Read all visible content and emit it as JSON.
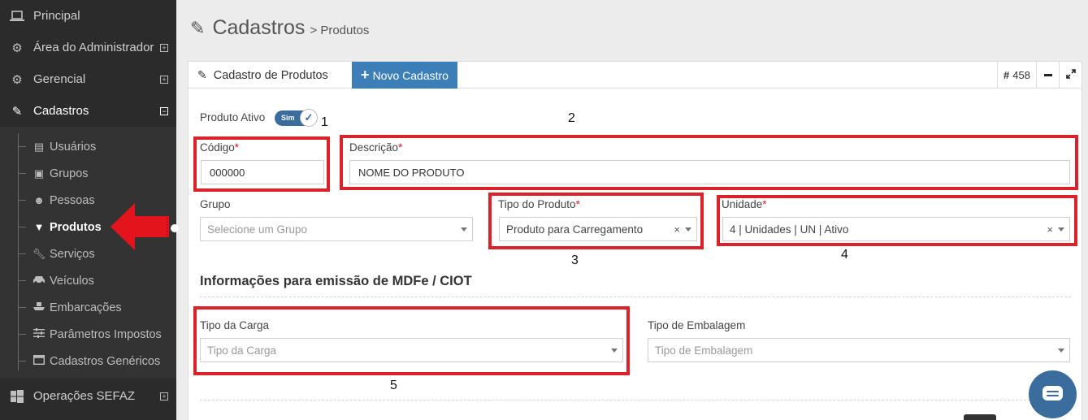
{
  "sidebar": {
    "items": [
      {
        "label": "Principal",
        "icon": "laptop-icon"
      },
      {
        "label": "Área do Administrador",
        "icon": "gears-icon",
        "expander": "⊞"
      },
      {
        "label": "Gerencial",
        "icon": "gears-icon",
        "expander": "⊞"
      },
      {
        "label": "Cadastros",
        "icon": "edit-icon",
        "expander": "⊟"
      }
    ],
    "subitems": [
      {
        "label": "Usuários",
        "icon": "id-card-icon"
      },
      {
        "label": "Grupos",
        "icon": "group-box-icon"
      },
      {
        "label": "Pessoas",
        "icon": "people-icon"
      },
      {
        "label": "Produtos",
        "icon": "shirt-icon"
      },
      {
        "label": "Serviços",
        "icon": "wrench-icon"
      },
      {
        "label": "Veículos",
        "icon": "car-icon"
      },
      {
        "label": "Embarcações",
        "icon": "ship-icon"
      },
      {
        "label": "Parâmetros Impostos",
        "icon": "sliders-icon"
      },
      {
        "label": "Cadastros Genéricos",
        "icon": "window-icon"
      }
    ],
    "bottom": {
      "label": "Operações SEFAZ",
      "icon": "windows-icon",
      "expander": "⊞"
    }
  },
  "page": {
    "title": "Cadastros",
    "crumb": "> Produtos"
  },
  "panel": {
    "title": "Cadastro de Produtos",
    "new_button": "Novo Cadastro",
    "record_id": "458"
  },
  "form": {
    "ativo_label": "Produto Ativo",
    "ativo_value": "Sim",
    "codigo_label": "Código",
    "codigo_value": "000000",
    "descricao_label": "Descrição",
    "descricao_value": "NOME DO PRODUTO",
    "grupo_label": "Grupo",
    "grupo_placeholder": "Selecione um Grupo",
    "tipo_produto_label": "Tipo do Produto",
    "tipo_produto_value": "Produto para Carregamento",
    "unidade_label": "Unidade",
    "unidade_value": "4 | Unidades | UN | Ativo",
    "required_mark": "*",
    "clear_mark": "×"
  },
  "mdfe": {
    "section_title": "Informações para emissão de MDFe / CIOT",
    "tipo_carga_label": "Tipo da Carga",
    "tipo_carga_placeholder": "Tipo da Carga",
    "tipo_embalagem_label": "Tipo de Embalagem",
    "tipo_embalagem_placeholder": "Tipo de Embalagem"
  },
  "annotations": [
    "1",
    "2",
    "3",
    "4",
    "5"
  ],
  "colors": {
    "sidebar_bg": "#2b2b2b",
    "primary_button": "#3c7fb8",
    "annotation_red": "#d9222a",
    "toggle_blue": "#3a6c9e"
  }
}
